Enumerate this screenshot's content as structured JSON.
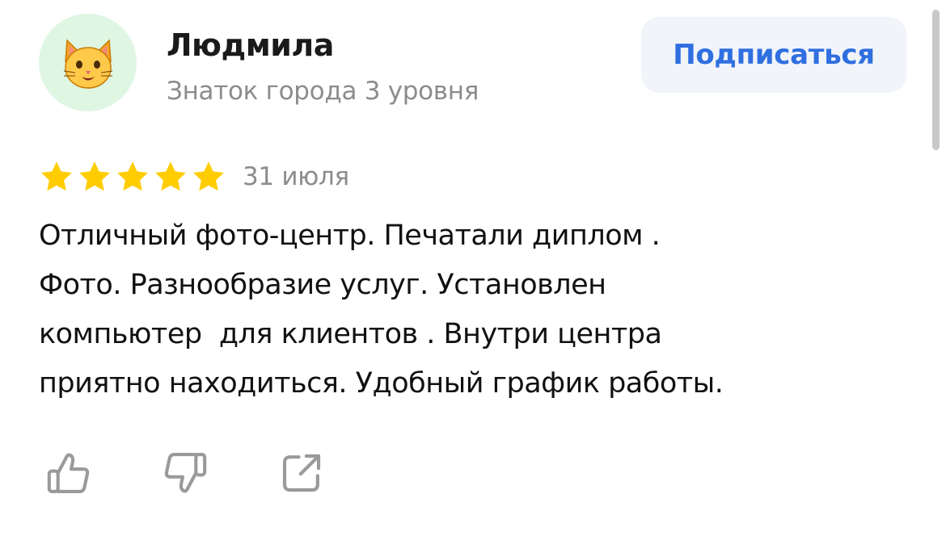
{
  "review": {
    "author": {
      "name": "Людмила",
      "level": "Знаток города 3 уровня",
      "avatar_icon": "cat-face-emoji"
    },
    "subscribe_label": "Подписаться",
    "rating": 5,
    "rating_max": 5,
    "date": "31 июля",
    "text_lines": [
      "Отличный фото-центр. Печатали диплом .",
      "Фото. Разнообразие услуг. Установлен",
      "компьютер  для клиентов . Внутри центра",
      "приятно находиться. Удобный график работы."
    ],
    "actions": [
      "thumbs-up-icon",
      "thumbs-down-icon",
      "share-icon"
    ]
  },
  "colors": {
    "accent": "#2f6fe0",
    "button_bg": "#f1f4f9",
    "star": "#ffcc00",
    "avatar_bg": "#dff6e3",
    "muted_text": "#8c8c8c",
    "icon": "#9a9a9a"
  }
}
